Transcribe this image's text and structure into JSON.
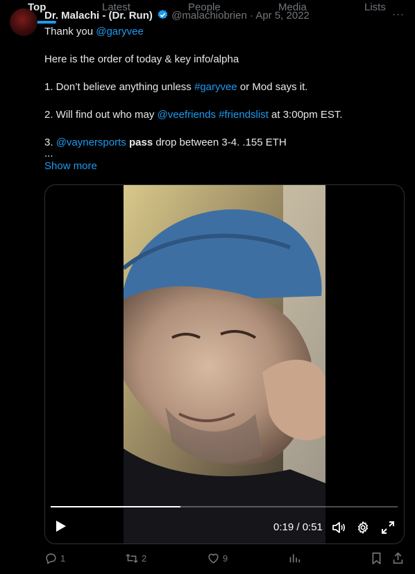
{
  "tabs": [
    {
      "label": "Top",
      "active": true
    },
    {
      "label": "Latest",
      "active": false
    },
    {
      "label": "People",
      "active": false
    },
    {
      "label": "Media",
      "active": false
    },
    {
      "label": "Lists",
      "active": false
    }
  ],
  "tweet": {
    "author": "Dr. Malachi - (Dr. Run)",
    "handle_date": "@malachiobrien · Apr 5, 2022",
    "more": "···",
    "lines": {
      "l1_prefix": "Thank you ",
      "l1_mention": "@garyvee",
      "l2": "Here is the order of today & key info/alpha",
      "l3_prefix": "1. Don’t believe anything unless ",
      "l3_tag": "#garyvee",
      "l3_suffix": " or Mod says it.",
      "l4_prefix": "2. Will find out who may ",
      "l4_mention": "@veefriends",
      "l4_space": " ",
      "l4_tag": "#friendslist",
      "l4_suffix": " at 3:00pm EST.",
      "l5_prefix": "3. ",
      "l5_mention": "@vaynersports",
      "l5_space": " ",
      "l5_bold": "pass",
      "l5_suffix": " drop between 3-4. .155 ETH",
      "ellipsis": "...",
      "show_more": "Show more"
    },
    "video": {
      "time": "0:19 / 0:51",
      "progress": 0.373
    },
    "actions": {
      "replies": "1",
      "retweets": "2",
      "likes": "9"
    }
  },
  "colors": {
    "accent": "#1d9bf0",
    "muted": "#71767b",
    "text": "#e7e9ea"
  }
}
